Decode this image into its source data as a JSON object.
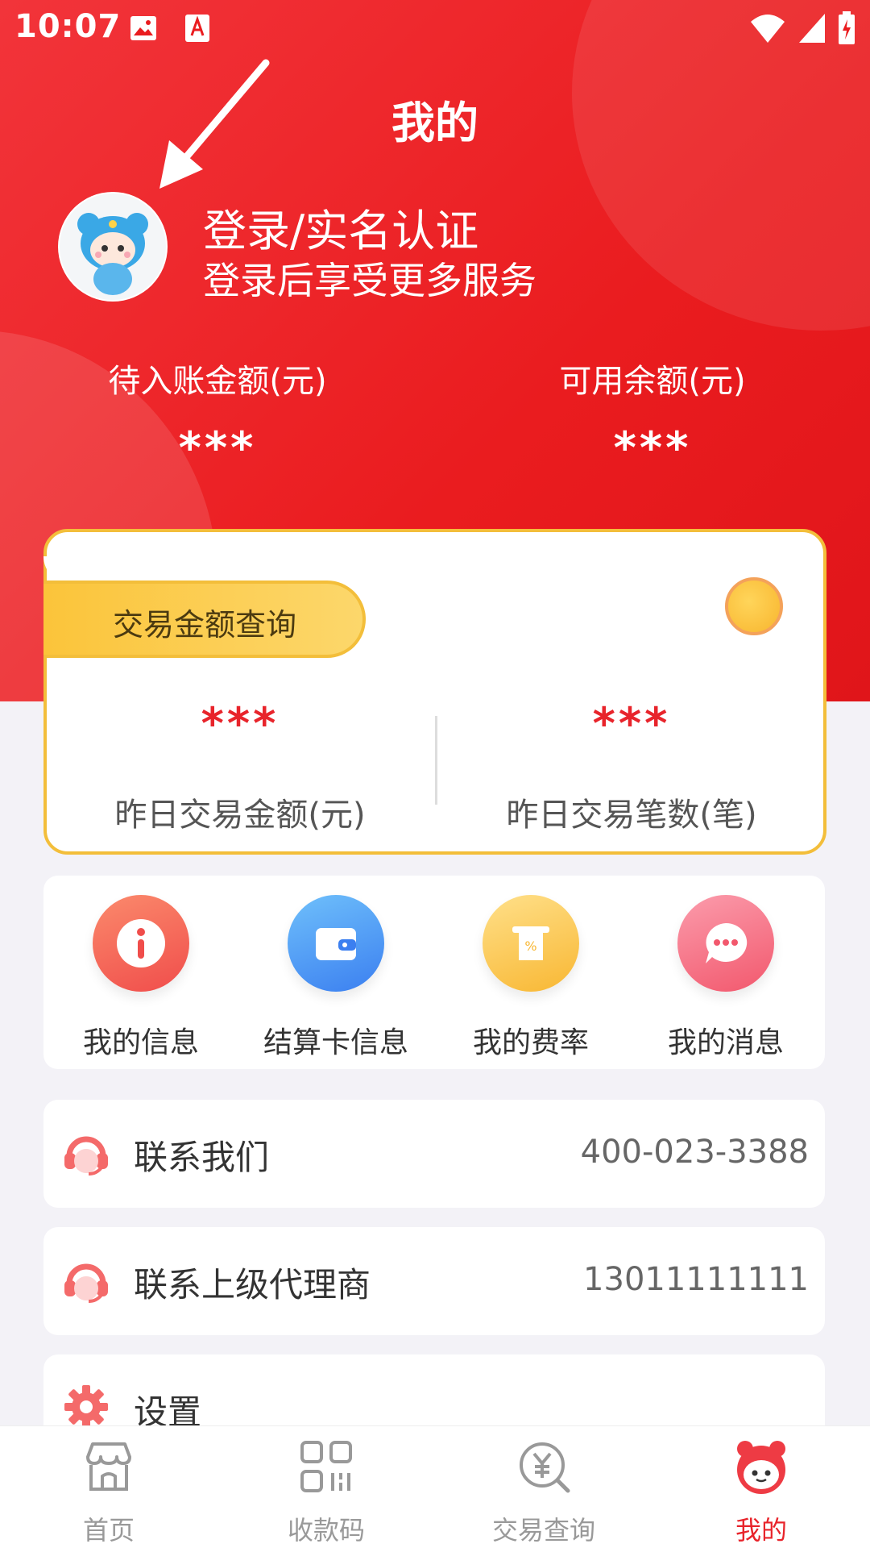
{
  "status_bar": {
    "time": "10:07"
  },
  "header": {
    "title": "我的"
  },
  "profile": {
    "login_title": "登录/实名认证",
    "login_subtitle": "登录后享受更多服务"
  },
  "balances": [
    {
      "label": "待入账金额(元)",
      "value": "***"
    },
    {
      "label": "可用余额(元)",
      "value": "***"
    }
  ],
  "trade_card": {
    "tab_label": "交易金额查询",
    "stats": [
      {
        "value": "***",
        "label": "昨日交易金额(元)"
      },
      {
        "value": "***",
        "label": "昨日交易笔数(笔)"
      }
    ]
  },
  "quick_actions": [
    {
      "label": "我的信息",
      "icon": "info-icon",
      "color": "#f46454"
    },
    {
      "label": "结算卡信息",
      "icon": "wallet-icon",
      "color": "#4e96f4"
    },
    {
      "label": "我的费率",
      "icon": "rate-icon",
      "color": "#fbc43a"
    },
    {
      "label": "我的消息",
      "icon": "message-icon",
      "color": "#f56d7e"
    }
  ],
  "rows": [
    {
      "label": "联系我们",
      "value": "400-023-3388",
      "icon": "headset-icon"
    },
    {
      "label": "联系上级代理商",
      "value": "13011111111",
      "icon": "headset-icon"
    },
    {
      "label": "设置",
      "value": "",
      "icon": "gear-icon"
    }
  ],
  "tabbar": [
    {
      "label": "首页",
      "icon": "store-icon"
    },
    {
      "label": "收款码",
      "icon": "qr-code-icon"
    },
    {
      "label": "交易查询",
      "icon": "yuan-search-icon"
    },
    {
      "label": "我的",
      "icon": "mascot-icon",
      "active": true
    }
  ],
  "colors": {
    "brand_red": "#e8242b",
    "gold": "#f3be3a"
  }
}
